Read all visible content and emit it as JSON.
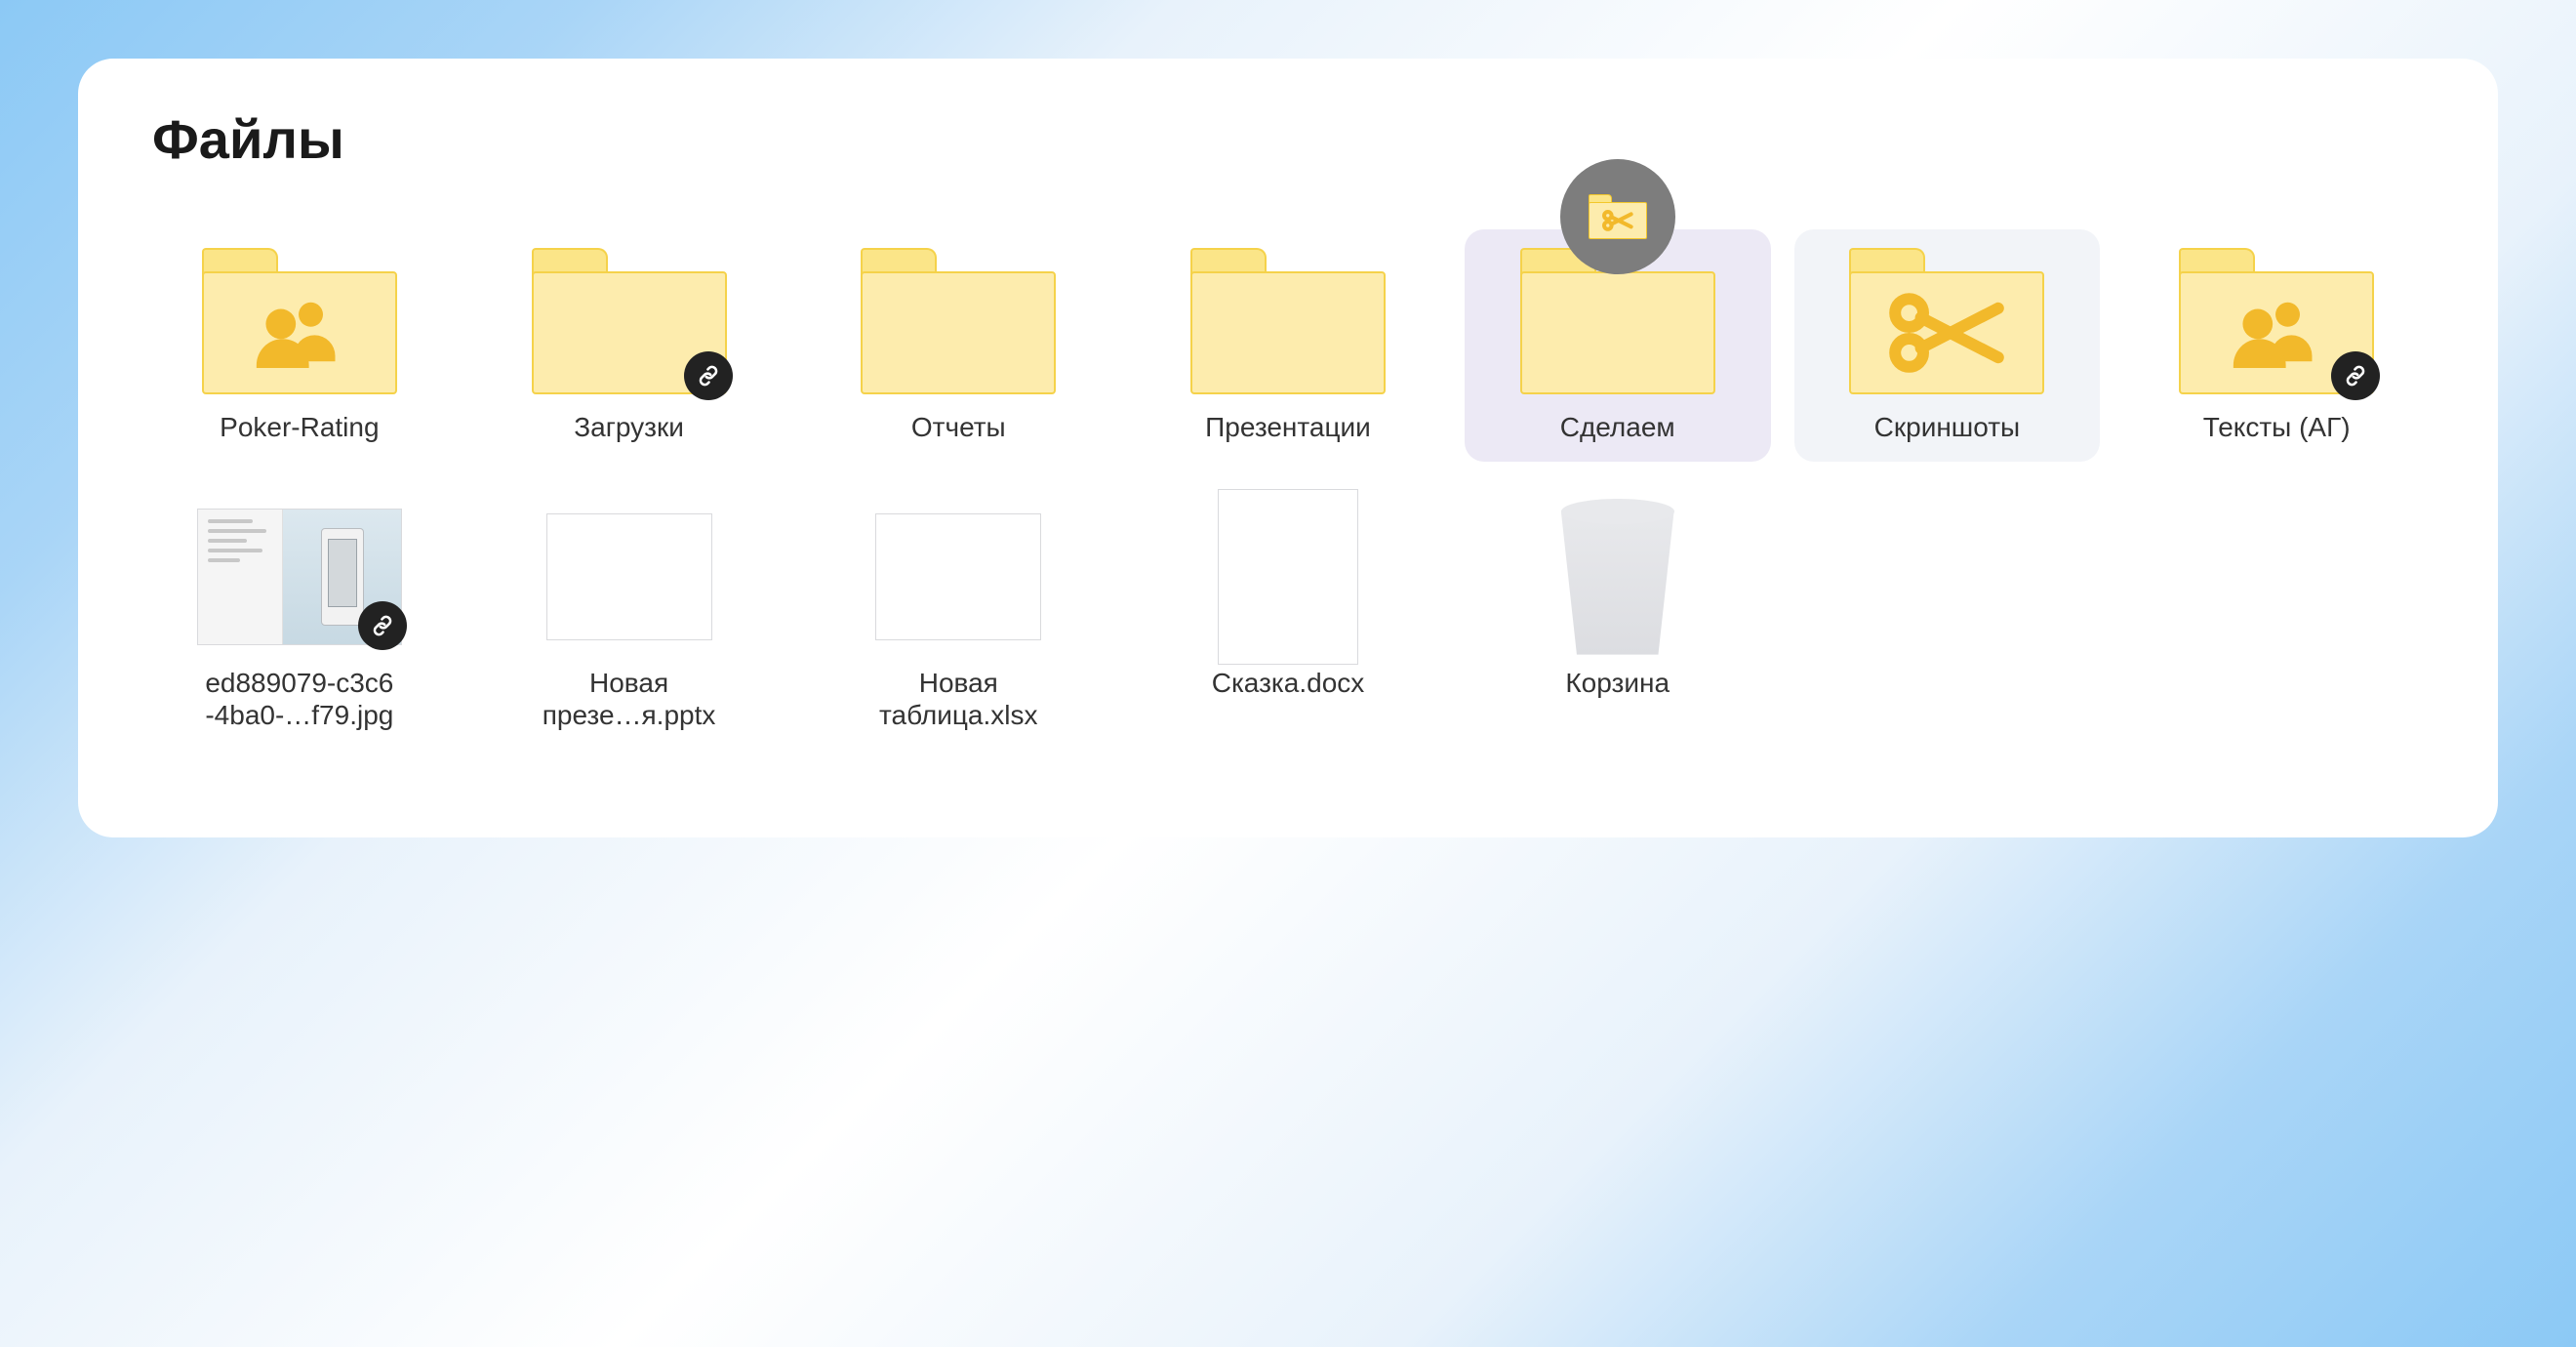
{
  "title": "Файлы",
  "items": [
    {
      "label": "Poker-Rating",
      "type": "folder",
      "overlay": "people",
      "badge": null,
      "state": ""
    },
    {
      "label": "Загрузки",
      "type": "folder",
      "overlay": null,
      "badge": "link",
      "state": ""
    },
    {
      "label": "Отчеты",
      "type": "folder",
      "overlay": null,
      "badge": null,
      "state": ""
    },
    {
      "label": "Презентации",
      "type": "folder",
      "overlay": null,
      "badge": null,
      "state": ""
    },
    {
      "label": "Сделаем",
      "type": "folder",
      "overlay": null,
      "badge": null,
      "state": "selected",
      "dragging": true
    },
    {
      "label": "Скриншоты",
      "type": "folder",
      "overlay": "scissors",
      "badge": null,
      "state": "hover"
    },
    {
      "label": "Тексты (АГ)",
      "type": "folder",
      "overlay": "people",
      "badge": "link",
      "state": ""
    },
    {
      "label": "ed889079-c3c6\n-4ba0-…f79.jpg",
      "type": "image",
      "badge": "link"
    },
    {
      "label": "Новая\nпрезе…я.pptx",
      "type": "file-wide"
    },
    {
      "label": "Новая\nтаблица.xlsx",
      "type": "file-wide"
    },
    {
      "label": "Сказка.docx",
      "type": "file-tall"
    },
    {
      "label": "Корзина",
      "type": "trash"
    }
  ]
}
